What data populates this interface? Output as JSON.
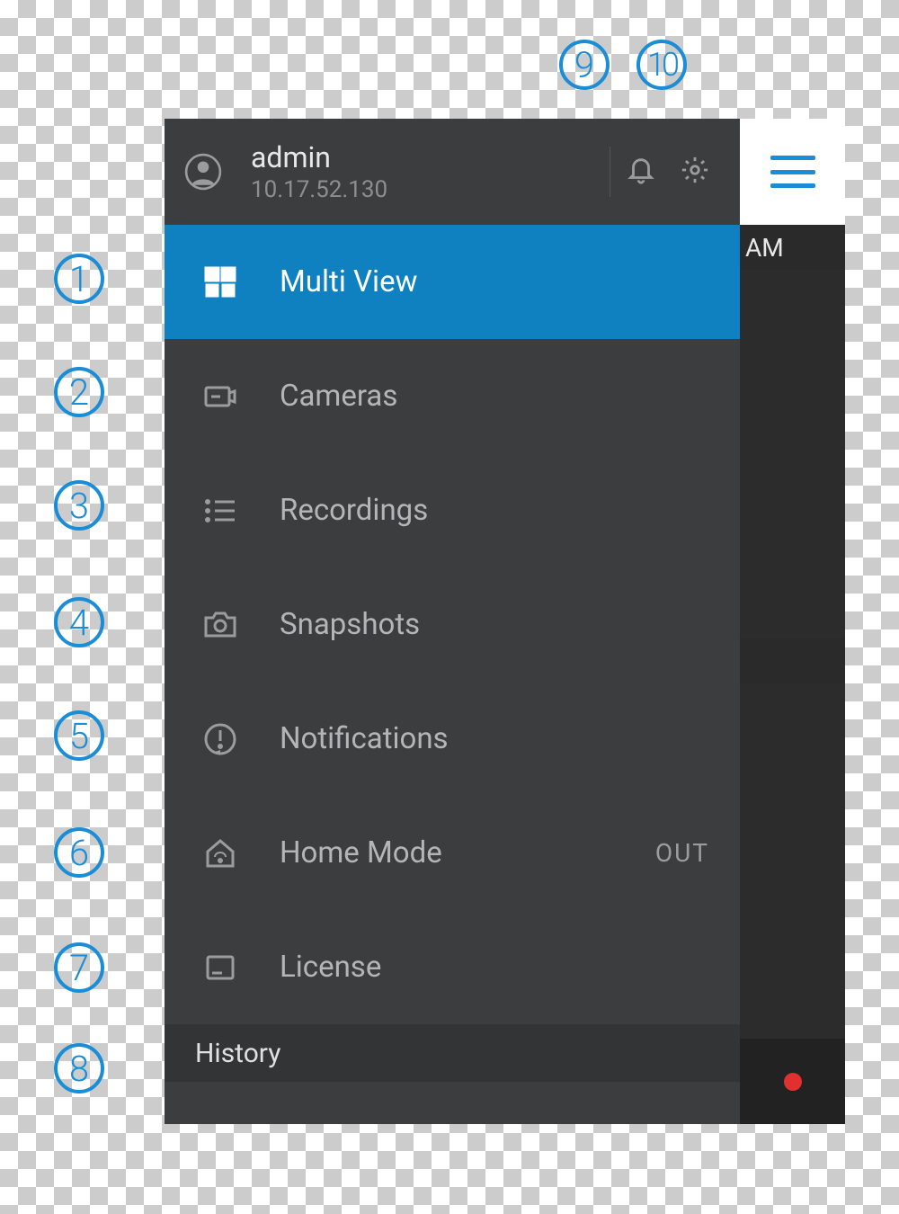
{
  "annotations": [
    "1",
    "2",
    "3",
    "4",
    "5",
    "6",
    "7",
    "8",
    "9",
    "10"
  ],
  "header": {
    "username": "admin",
    "ip": "10.17.52.130"
  },
  "menu": {
    "items": [
      {
        "label": "Multi View",
        "active": true
      },
      {
        "label": "Cameras"
      },
      {
        "label": "Recordings"
      },
      {
        "label": "Snapshots"
      },
      {
        "label": "Notifications"
      },
      {
        "label": "Home Mode",
        "trailing": "OUT"
      },
      {
        "label": "License"
      }
    ]
  },
  "section": {
    "history_label": "History"
  },
  "peek": {
    "am_label": "AM"
  }
}
